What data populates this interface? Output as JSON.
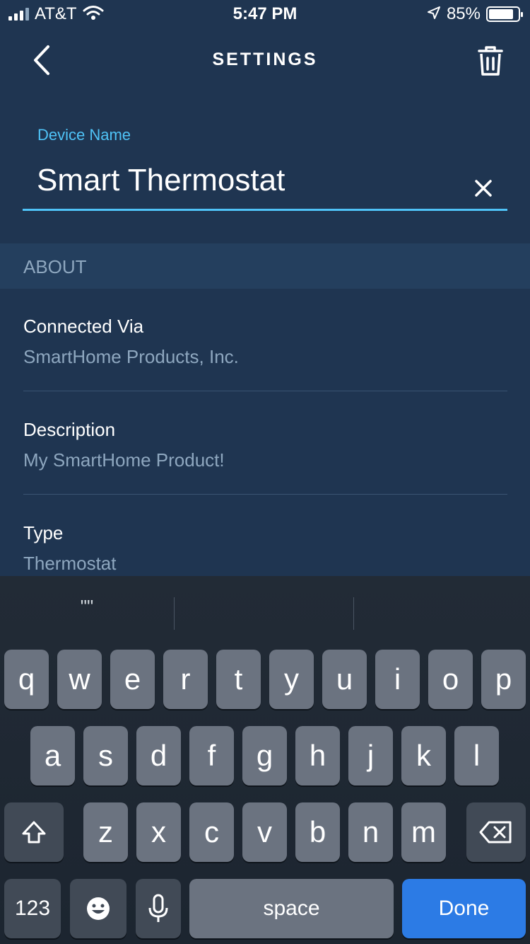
{
  "status_bar": {
    "carrier": "AT&T",
    "time": "5:47 PM",
    "battery_text": "85%",
    "battery_level": 0.85,
    "icons": [
      "signal-icon",
      "wifi-icon",
      "location-icon",
      "battery-icon"
    ]
  },
  "nav": {
    "title": "SETTINGS",
    "back_icon": "back-chevron-icon",
    "delete_icon": "trash-icon"
  },
  "device_name": {
    "label": "Device Name",
    "value": "Smart Thermostat",
    "clear_icon": "close-icon"
  },
  "about": {
    "header": "ABOUT",
    "items": [
      {
        "label": "Connected Via",
        "value": "SmartHome Products, Inc."
      },
      {
        "label": "Description",
        "value": "My SmartHome Product!"
      },
      {
        "label": "Type",
        "value": "Thermostat"
      }
    ]
  },
  "keyboard": {
    "suggestions": [
      "\"\"",
      "",
      ""
    ],
    "row1": [
      "q",
      "w",
      "e",
      "r",
      "t",
      "y",
      "u",
      "i",
      "o",
      "p"
    ],
    "row2": [
      "a",
      "s",
      "d",
      "f",
      "g",
      "h",
      "j",
      "k",
      "l"
    ],
    "row3": [
      "z",
      "x",
      "c",
      "v",
      "b",
      "n",
      "m"
    ],
    "numbers_label": "123",
    "space_label": "space",
    "done_label": "Done",
    "colors": {
      "key": "#6b7380",
      "dark_key": "#414a56",
      "done": "#2c7be5"
    }
  },
  "colors": {
    "background": "#1f3551",
    "accent": "#4fc3f7",
    "section_bg": "#243f5e",
    "secondary_text": "#8ea7bf"
  }
}
